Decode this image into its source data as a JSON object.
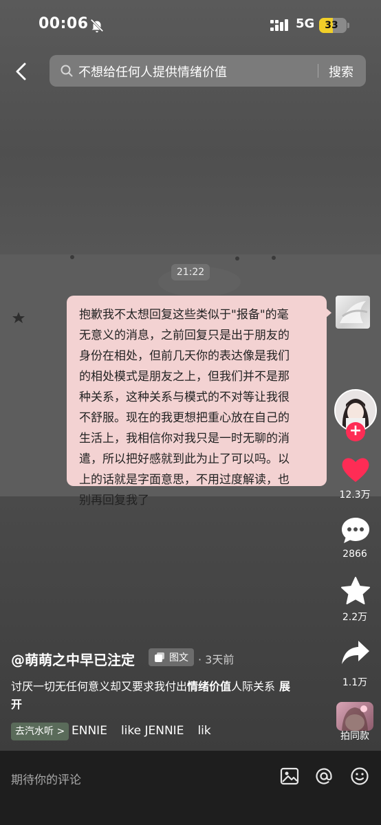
{
  "status_bar": {
    "time": "00:06",
    "network": "5G",
    "battery": "33"
  },
  "search": {
    "query": "不想给任何人提供情绪价值",
    "button_label": "搜索"
  },
  "chat": {
    "timestamp": "21:22",
    "message_lines": [
      "抱歉我不太想回复这些类似于\"报备\"的毫",
      "无意义的消息，之前回复只是出于朋友的",
      "身份在相处，但前几天你的表达像是我们",
      "的相处模式是朋友之上，但我们并不是那",
      "种关系，这种关系与模式的不对等让我很",
      "不舒服。现在的我更想把重心放在自己的",
      "生活上，我相信你对我只是一时无聊的消",
      "遣，所以把好感就到此为止了可以吗。以",
      "上的话就是字面意思，不用过度解读，也",
      "别再回复我了"
    ]
  },
  "rail": {
    "like_count": "12.3万",
    "comment_count": "2866",
    "favorite_count": "2.2万",
    "share_count": "1.1万",
    "remix_label": "拍同款",
    "follow_label": "+"
  },
  "post": {
    "author": "@萌萌之中早已注定",
    "type_badge": "图文",
    "time": "· 3天前",
    "caption_prefix": "讨厌一切无任何意义却又要求我付出",
    "caption_highlight": "情绪价值",
    "caption_suffix": "人际关系",
    "expand_label": "展开",
    "music_chip": "去汽水听 >",
    "music_track_items": [
      "ENNIE",
      "like JENNIE",
      "lik"
    ]
  },
  "comment_bar": {
    "placeholder": "期待你的评论"
  },
  "colors": {
    "like": "#fe2c55",
    "bubble": "#f3d2d2",
    "battery": "#f1cf28"
  }
}
